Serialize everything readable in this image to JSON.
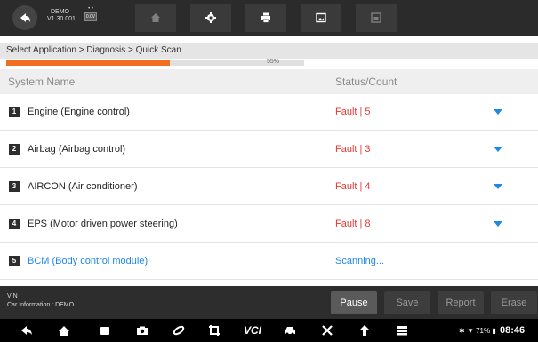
{
  "toolbar": {
    "demo_label": "DEMO",
    "version": "V1.30.001",
    "badge_voltage": "0.0V",
    "buttons": [
      {
        "name": "home-button",
        "icon": "home-icon"
      },
      {
        "name": "settings-button",
        "icon": "gear-icon"
      },
      {
        "name": "print-button",
        "icon": "printer-icon"
      },
      {
        "name": "screenshot-button",
        "icon": "image-icon"
      },
      {
        "name": "save-data-button",
        "icon": "save-icon"
      }
    ]
  },
  "breadcrumb": "Select Application > Diagnosis > Quick Scan",
  "progress": {
    "percent": 55,
    "label": "55%"
  },
  "table": {
    "col_name": "System Name",
    "col_status": "Status/Count",
    "rows": [
      {
        "num": "1",
        "name": "Engine (Engine control)",
        "status": "Fault | 5"
      },
      {
        "num": "2",
        "name": "Airbag (Airbag control)",
        "status": "Fault | 3"
      },
      {
        "num": "3",
        "name": "AIRCON (Air conditioner)",
        "status": "Fault | 4"
      },
      {
        "num": "4",
        "name": "EPS (Motor driven power steering)",
        "status": "Fault | 8"
      },
      {
        "num": "5",
        "name": "BCM (Body control module)",
        "status": "Scanning..."
      }
    ]
  },
  "footer": {
    "vin_label": "VIN :",
    "car_info": "Car Information : DEMO",
    "pause": "Pause",
    "save": "Save",
    "report": "Report",
    "erase": "Erase"
  },
  "statusbar": {
    "battery": "71%",
    "time": "08:46",
    "vci_label": "VCI"
  },
  "colors": {
    "accent": "#1e88e5",
    "fault": "#e53935",
    "progress": "#f26f21"
  }
}
